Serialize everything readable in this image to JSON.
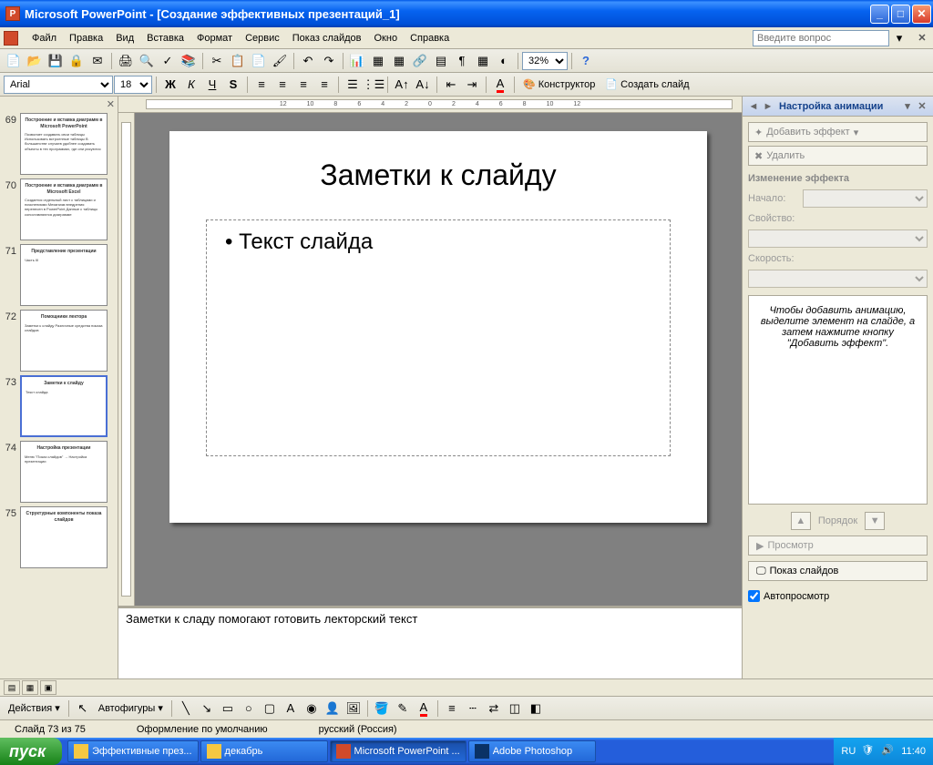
{
  "titlebar": {
    "app_name": "Microsoft PowerPoint",
    "doc_name": "[Создание эффективных презентаций_1]"
  },
  "menubar": {
    "items": [
      "Файл",
      "Правка",
      "Вид",
      "Вставка",
      "Формат",
      "Сервис",
      "Показ слайдов",
      "Окно",
      "Справка"
    ],
    "help_placeholder": "Введите вопрос"
  },
  "toolbar_std": {
    "zoom": "32%"
  },
  "toolbar_fmt": {
    "font_name": "Arial",
    "font_size": "18",
    "designer_label": "Конструктор",
    "new_slide_label": "Создать слайд"
  },
  "ruler": {
    "ticks": [
      "12",
      "10",
      "8",
      "6",
      "4",
      "2",
      "0",
      "2",
      "4",
      "6",
      "8",
      "10",
      "12"
    ]
  },
  "thumbnails": {
    "items": [
      {
        "num": "69",
        "title": "Построение и вставка диаграмм в Microsoft PowerPoint",
        "body": "Позволяет создавать свои таблицы\nИспользовать встроенные таблицы\n\nВ большинстве случаев удобнее создавать объекты в тех программах, где они рисуются"
      },
      {
        "num": "70",
        "title": "Построение и вставка диаграмм в Microsoft Excel",
        "body": "Создается отдельный лист с таблицами и пояснениями\nМеханизм внедрения перенесен в PowerPoint\nДанные с таблицы сопоставляются диаграмме"
      },
      {
        "num": "71",
        "title": "Представление презентации",
        "body": "Часть III"
      },
      {
        "num": "72",
        "title": "Помощники лектора",
        "body": "Заметки к слайду\nРазличные средства показа слайдов"
      },
      {
        "num": "73",
        "title": "Заметки к слайду",
        "body": "Текст слайда"
      },
      {
        "num": "74",
        "title": "Настройка презентации",
        "body": "Меню \"Показ слайдов\" → Настройка презентации"
      },
      {
        "num": "75",
        "title": "Структурные компоненты показа слайдов",
        "body": ""
      }
    ],
    "selected_index": 4
  },
  "slide": {
    "title": "Заметки к слайду",
    "bullet1": "Текст слайда"
  },
  "notes": {
    "text": "Заметки к сладу помогают готовить лекторский текст"
  },
  "task_pane": {
    "title": "Настройка анимации",
    "add_effect": "Добавить эффект",
    "remove": "Удалить",
    "change_section": "Изменение эффекта",
    "start_label": "Начало:",
    "property_label": "Свойство:",
    "speed_label": "Скорость:",
    "info_text": "Чтобы добавить анимацию, выделите элемент на слайде, а затем нажмите кнопку \"Добавить эффект\".",
    "order_label": "Порядок",
    "preview": "Просмотр",
    "slideshow": "Показ слайдов",
    "autopreview": "Автопросмотр"
  },
  "drawing": {
    "actions_label": "Действия",
    "autoshapes_label": "Автофигуры"
  },
  "statusbar": {
    "slide_info": "Слайд 73 из 75",
    "design": "Оформление по умолчанию",
    "language": "русский (Россия)"
  },
  "taskbar": {
    "start": "пуск",
    "items": [
      {
        "label": "Эффективные през...",
        "icon": "folder"
      },
      {
        "label": "декабрь",
        "icon": "folder"
      },
      {
        "label": "Microsoft PowerPoint ...",
        "icon": "ppt",
        "active": true
      },
      {
        "label": "Adobe Photoshop",
        "icon": "ps"
      }
    ],
    "lang": "RU",
    "clock": "11:40"
  }
}
